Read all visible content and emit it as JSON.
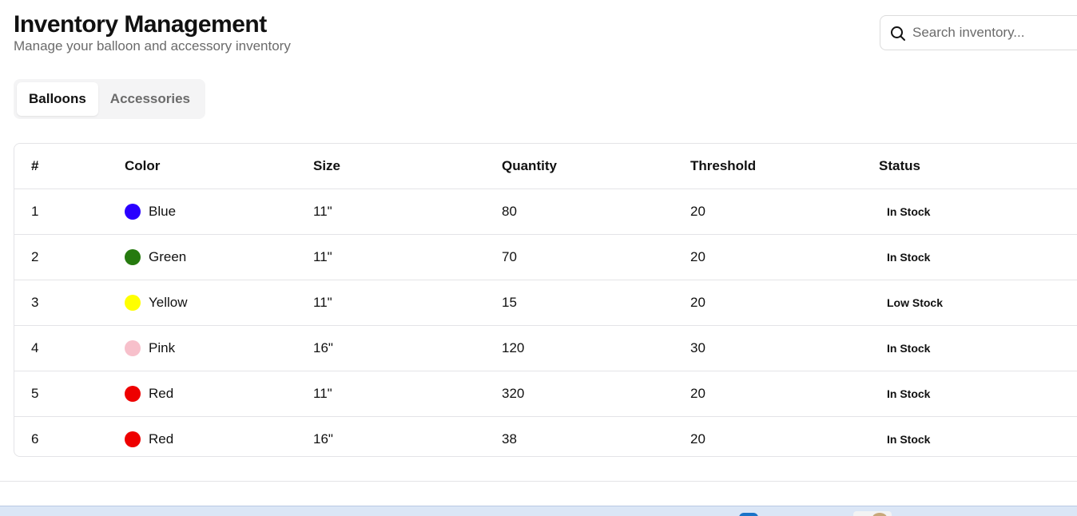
{
  "header": {
    "title": "Inventory Management",
    "subtitle": "Manage your balloon and accessory inventory"
  },
  "search": {
    "placeholder": "Search inventory...",
    "value": "",
    "icon": "search-icon"
  },
  "tabs": [
    {
      "label": "Balloons",
      "active": true
    },
    {
      "label": "Accessories",
      "active": false
    }
  ],
  "table": {
    "columns": [
      "#",
      "Color",
      "Size",
      "Quantity",
      "Threshold",
      "Status"
    ],
    "rows": [
      {
        "num": "1",
        "color": "Blue",
        "swatch": "#2a00ff",
        "size": "11\"",
        "quantity": "80",
        "threshold": "20",
        "status": "In Stock"
      },
      {
        "num": "2",
        "color": "Green",
        "swatch": "#267a0f",
        "size": "11\"",
        "quantity": "70",
        "threshold": "20",
        "status": "In Stock"
      },
      {
        "num": "3",
        "color": "Yellow",
        "swatch": "#ffff00",
        "size": "11\"",
        "quantity": "15",
        "threshold": "20",
        "status": "Low Stock"
      },
      {
        "num": "4",
        "color": "Pink",
        "swatch": "#f7c0cb",
        "size": "16\"",
        "quantity": "120",
        "threshold": "30",
        "status": "In Stock"
      },
      {
        "num": "5",
        "color": "Red",
        "swatch": "#ee0000",
        "size": "11\"",
        "quantity": "320",
        "threshold": "20",
        "status": "In Stock"
      },
      {
        "num": "6",
        "color": "Red",
        "swatch": "#ee0000",
        "size": "16\"",
        "quantity": "38",
        "threshold": "20",
        "status": "In Stock"
      }
    ]
  },
  "colors": {
    "border": "#e4e4e7",
    "muted_text": "#6b6b6b",
    "tab_bg": "#f4f4f5"
  }
}
